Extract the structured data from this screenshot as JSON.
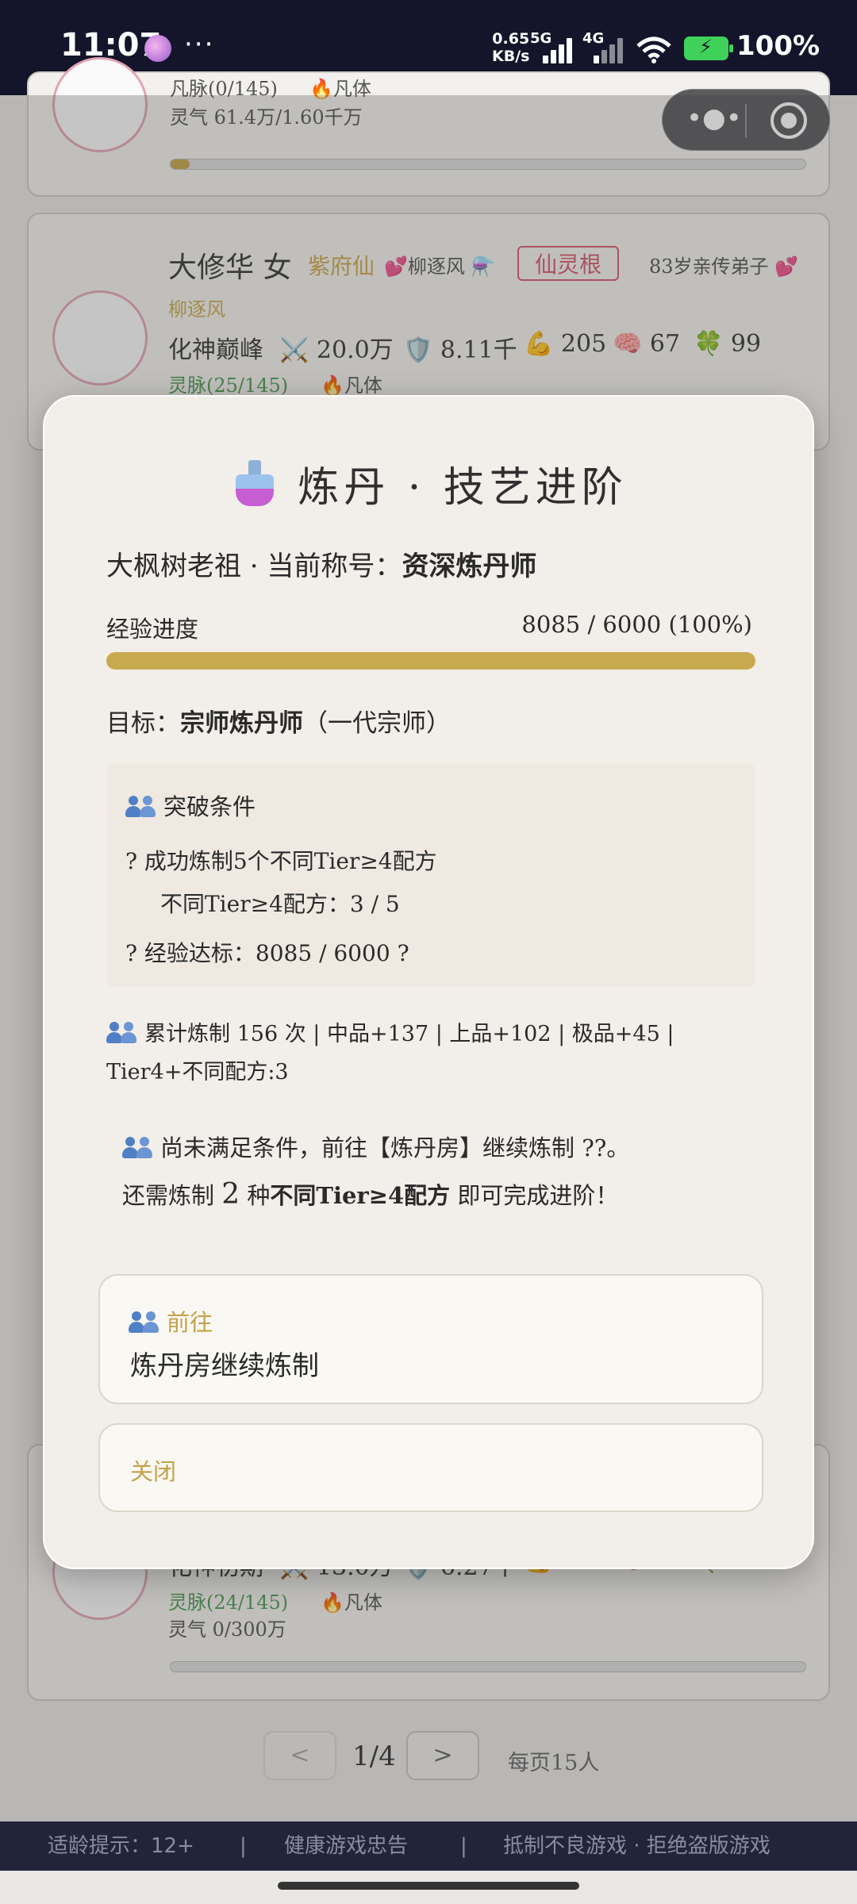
{
  "status_bar": {
    "time": "11:07",
    "more": "···",
    "speed_value": "0.65",
    "speed_unit": "KB/s",
    "net1": "5G",
    "net2": "4G",
    "battery": "100%"
  },
  "background": {
    "card_a": {
      "meridian": "凡脉(0/145)",
      "body": "🔥凡体",
      "lingqi": "灵气 61.4万/1.60千万",
      "progress": 0.03
    },
    "card_b": {
      "name": "大修华 女",
      "title": "紫府仙",
      "partner": "💕柳逐风 ⚗️",
      "root_tag": "仙灵根",
      "role": "83岁亲传弟子 💕",
      "partner2": "柳逐风",
      "realm": "化神巅峰",
      "attack": "⚔️ 20.0万",
      "defense": "🛡️ 8.11千",
      "strength": "💪 205",
      "intellect": "🧠 67",
      "luck": "🍀 99",
      "meridian": "灵脉(25/145)",
      "body": "🔥凡体"
    },
    "card_c": {
      "realm": "化神初期",
      "attack": "⚔️ 13.0万",
      "defense": "🛡️ 6.27千",
      "strength": "💪 173",
      "intellect": "🧠 65",
      "luck": "🍀 43",
      "meridian": "灵脉(24/145)",
      "body": "🔥凡体",
      "lingqi": "灵气 0/300万",
      "progress": 0
    },
    "pager": {
      "prev": "<",
      "page": "1/4",
      "next": ">",
      "per_page": "每页15人"
    },
    "footer": {
      "age": "适龄提示：12+",
      "sep": "|",
      "health": "健康游戏忠告",
      "anti": "抵制不良游戏 · 拒绝盗版游戏"
    }
  },
  "modal": {
    "title": "炼丹 · 技艺进阶",
    "owner_prefix": "大枫树老祖 · 当前称号：",
    "current_title": "资深炼丹师",
    "exp_label": "经验进度",
    "exp_value": "8085 / 6000 (100%)",
    "exp_fraction": 1.0,
    "target_prefix": "目标：",
    "target_title": "宗师炼丹师",
    "target_suffix": "（一代宗师）",
    "conditions": {
      "heading": "突破条件",
      "item1": "? 成功炼制5个不同Tier≥4配方",
      "item1_sub": "不同Tier≥4配方：3 / 5",
      "item2": "? 经验达标：8085 / 6000 ?"
    },
    "stats": "累计炼制 156 次 | 中品+137 | 上品+102 | 极品+45 | Tier4+不同配方:3",
    "notice1": "尚未满足条件，前往【炼丹房】继续炼制 ??。",
    "notice2_a": "还需炼制",
    "notice2_num": "2",
    "notice2_b": "种",
    "notice2_bold": "不同Tier≥4配方",
    "notice2_c": "即可完成进阶！",
    "go_small": "前往",
    "go_main": "炼丹房继续炼制",
    "close": "关闭"
  }
}
